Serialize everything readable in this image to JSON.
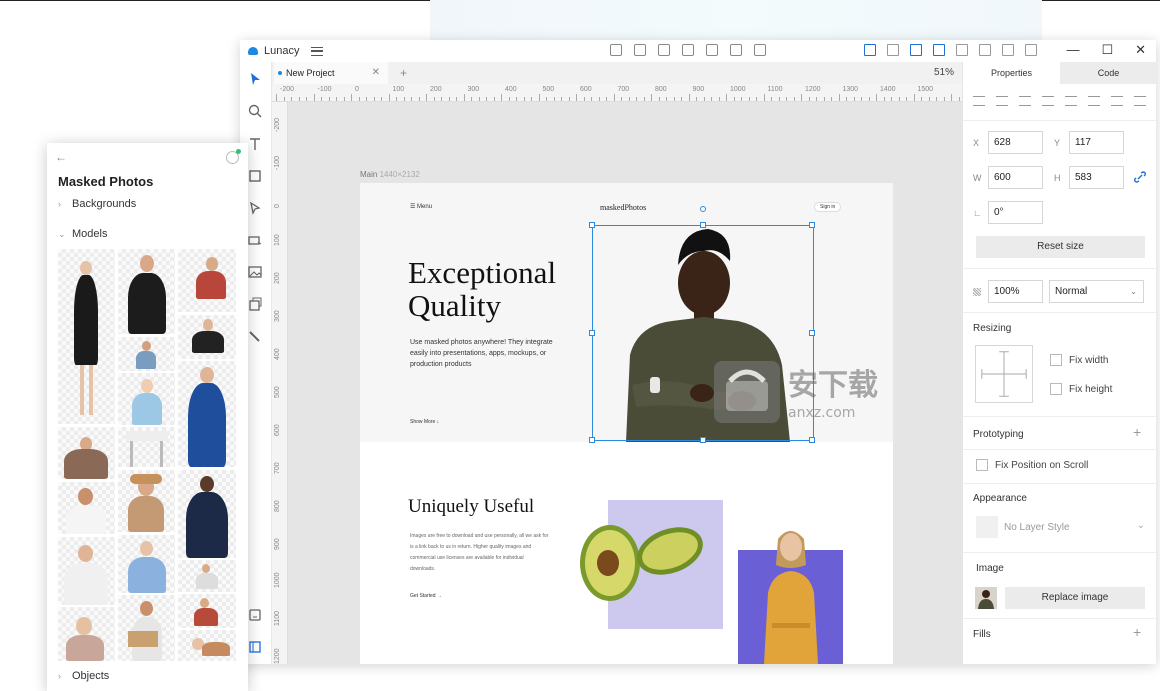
{
  "app": {
    "name": "Lunacy",
    "tab_label": "New Project",
    "zoom": "51%",
    "window_controls": [
      "—",
      "☐",
      "✕"
    ]
  },
  "rulers": {
    "horizontal": [
      "-200",
      "-100",
      "0",
      "100",
      "200",
      "300",
      "400",
      "500",
      "600",
      "700",
      "800",
      "900",
      "1000",
      "1100",
      "1200",
      "1300",
      "1400",
      "1500"
    ],
    "vertical": [
      "-200",
      "-100",
      "0",
      "100",
      "200",
      "300",
      "400",
      "500",
      "600",
      "700",
      "800",
      "900",
      "1000",
      "1100",
      "1200"
    ]
  },
  "artboard": {
    "name": "Main",
    "size": "1440×2132",
    "menu_label": "Menu",
    "brand": "maskedPhotos",
    "signin_label": "Sign in",
    "hero_title": "Exceptional Quality",
    "hero_text": "Use masked photos anywhere! They integrate easily into presentations, apps, mockups, or production products",
    "show_more": "Show More",
    "section2_title": "Uniquely Useful",
    "section2_text": "Images are free to download and use personally, all we ask for is a link back to us in return. Higher quality images and commercial use licenses are available for individual downloads.",
    "get_started": "Get Started"
  },
  "watermark": {
    "text": "安下载",
    "subtext": "anxz.com"
  },
  "properties": {
    "tabs": [
      "Properties",
      "Code"
    ],
    "x_label": "X",
    "x": "628",
    "y_label": "Y",
    "y": "117",
    "w_label": "W",
    "w": "600",
    "h_label": "H",
    "h": "583",
    "rotation": "0°",
    "reset_size": "Reset size",
    "opacity": "100%",
    "blend_mode": "Normal",
    "resizing_title": "Resizing",
    "fix_width": "Fix width",
    "fix_height": "Fix height",
    "prototyping_title": "Prototyping",
    "fix_position": "Fix Position on Scroll",
    "appearance_title": "Appearance",
    "layer_style": "No Layer Style",
    "image_title": "Image",
    "replace_image": "Replace image",
    "fills_title": "Fills"
  },
  "assets_panel": {
    "title": "Masked Photos",
    "categories": [
      "Backgrounds",
      "Models",
      "Objects"
    ]
  },
  "colors": {
    "accent": "#1e6fd9",
    "selection": "#2b8be0",
    "avocado_bg": "#ccc8ee",
    "person_bg": "#6b5fd6"
  }
}
